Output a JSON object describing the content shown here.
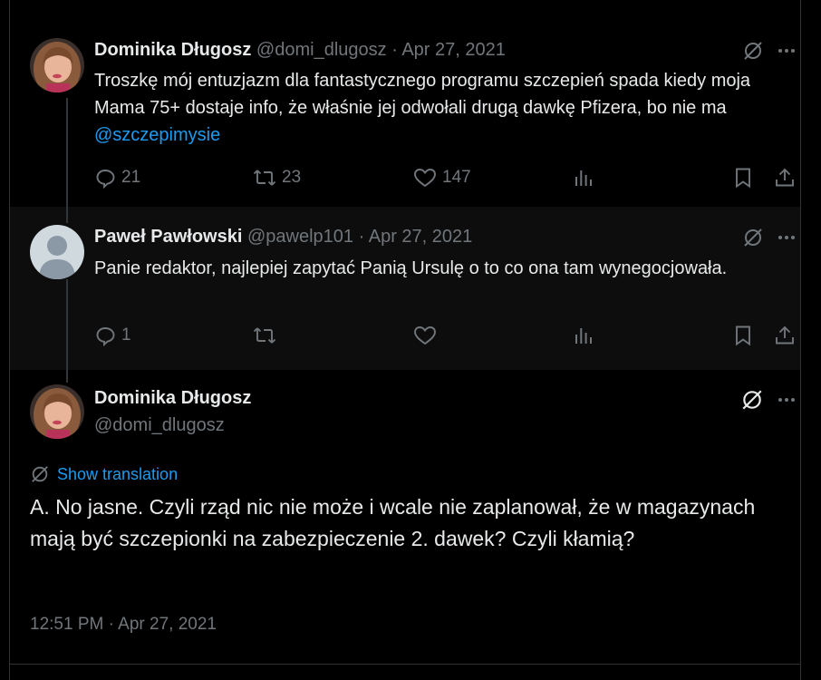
{
  "tweets": [
    {
      "name": "Dominika Długosz",
      "handle": "@domi_dlugosz",
      "separator": "·",
      "date": "Apr 27, 2021",
      "text_before": "Troszkę mój entuzjazm dla fantastycznego programu szczepień spada kiedy moja Mama 75+ dostaje info, że właśnie jej odwołali drugą dawkę Pfizera, bo nie ma ",
      "mention": "@szczepimysie",
      "actions": {
        "replies": "21",
        "retweets": "23",
        "likes": "147"
      }
    },
    {
      "name": "Paweł Pawłowski",
      "handle": "@pawelp101",
      "separator": "·",
      "date": "Apr 27, 2021",
      "text": "Panie redaktor, najlepiej zapytać Panią Ursulę o to co ona tam wynegocjowała.",
      "actions": {
        "replies": "1"
      }
    }
  ],
  "main_tweet": {
    "name": "Dominika Długosz",
    "handle": "@domi_dlugosz",
    "translate_label": "Show translation",
    "text": "A. No jasne. Czyli rząd nic nie może i wcale nie zaplanował, że w magazynach mają być szczepionki na zabezpieczenie 2. dawek? Czyli kłamią?",
    "timestamp": "12:51 PM · Apr 27, 2021"
  },
  "colors": {
    "background": "#000000",
    "text": "#e7e9ea",
    "muted": "#71767b",
    "accent": "#1d9bf0",
    "divider": "#2f3336"
  },
  "icons": [
    "grok-icon",
    "more-icon",
    "reply-icon",
    "retweet-icon",
    "like-icon",
    "views-icon",
    "bookmark-icon",
    "share-icon",
    "translate-icon"
  ]
}
